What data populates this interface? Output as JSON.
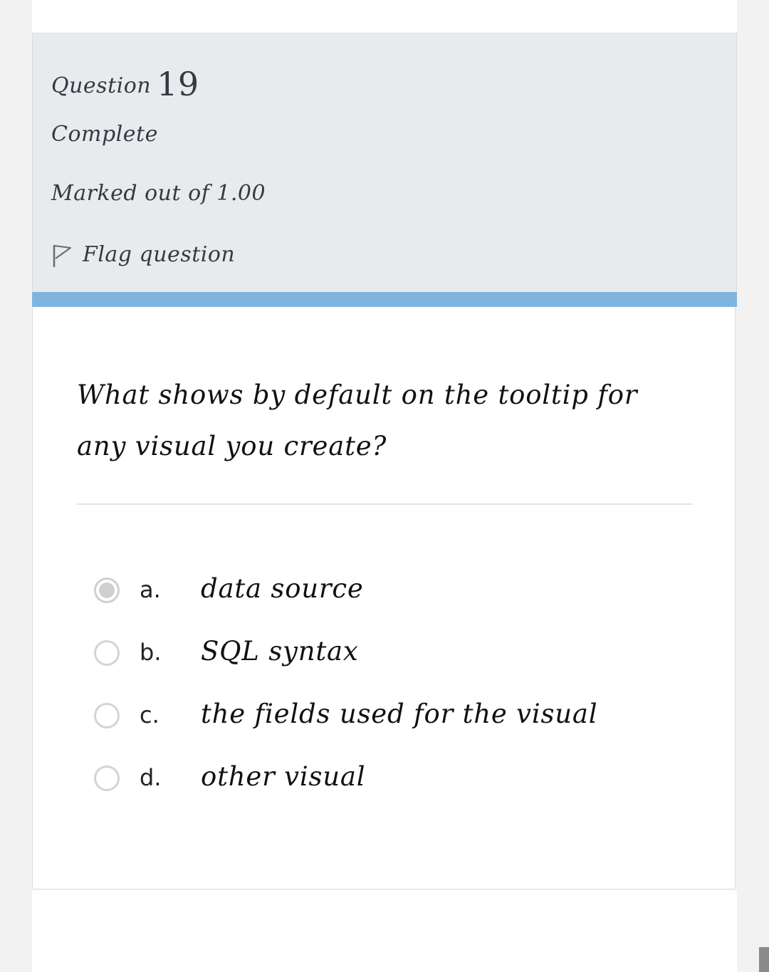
{
  "question": {
    "label": "Question",
    "number": "19",
    "state": "Complete",
    "grade": "Marked out of 1.00",
    "flag_label": "Flag question",
    "text": "What shows by default on the tooltip for any visual you create?"
  },
  "answers": [
    {
      "letter": "a.",
      "text": "data source",
      "selected": true
    },
    {
      "letter": "b.",
      "text": "SQL syntax",
      "selected": false
    },
    {
      "letter": "c.",
      "text": "the fields used for the visual",
      "selected": false
    },
    {
      "letter": "d.",
      "text": "other visual",
      "selected": false
    }
  ],
  "colors": {
    "info_panel_bg": "#e7ebee",
    "accent_bar": "#81b4dd",
    "page_bg": "#f2f2f2"
  },
  "icons": {
    "flag": "flag-icon"
  }
}
